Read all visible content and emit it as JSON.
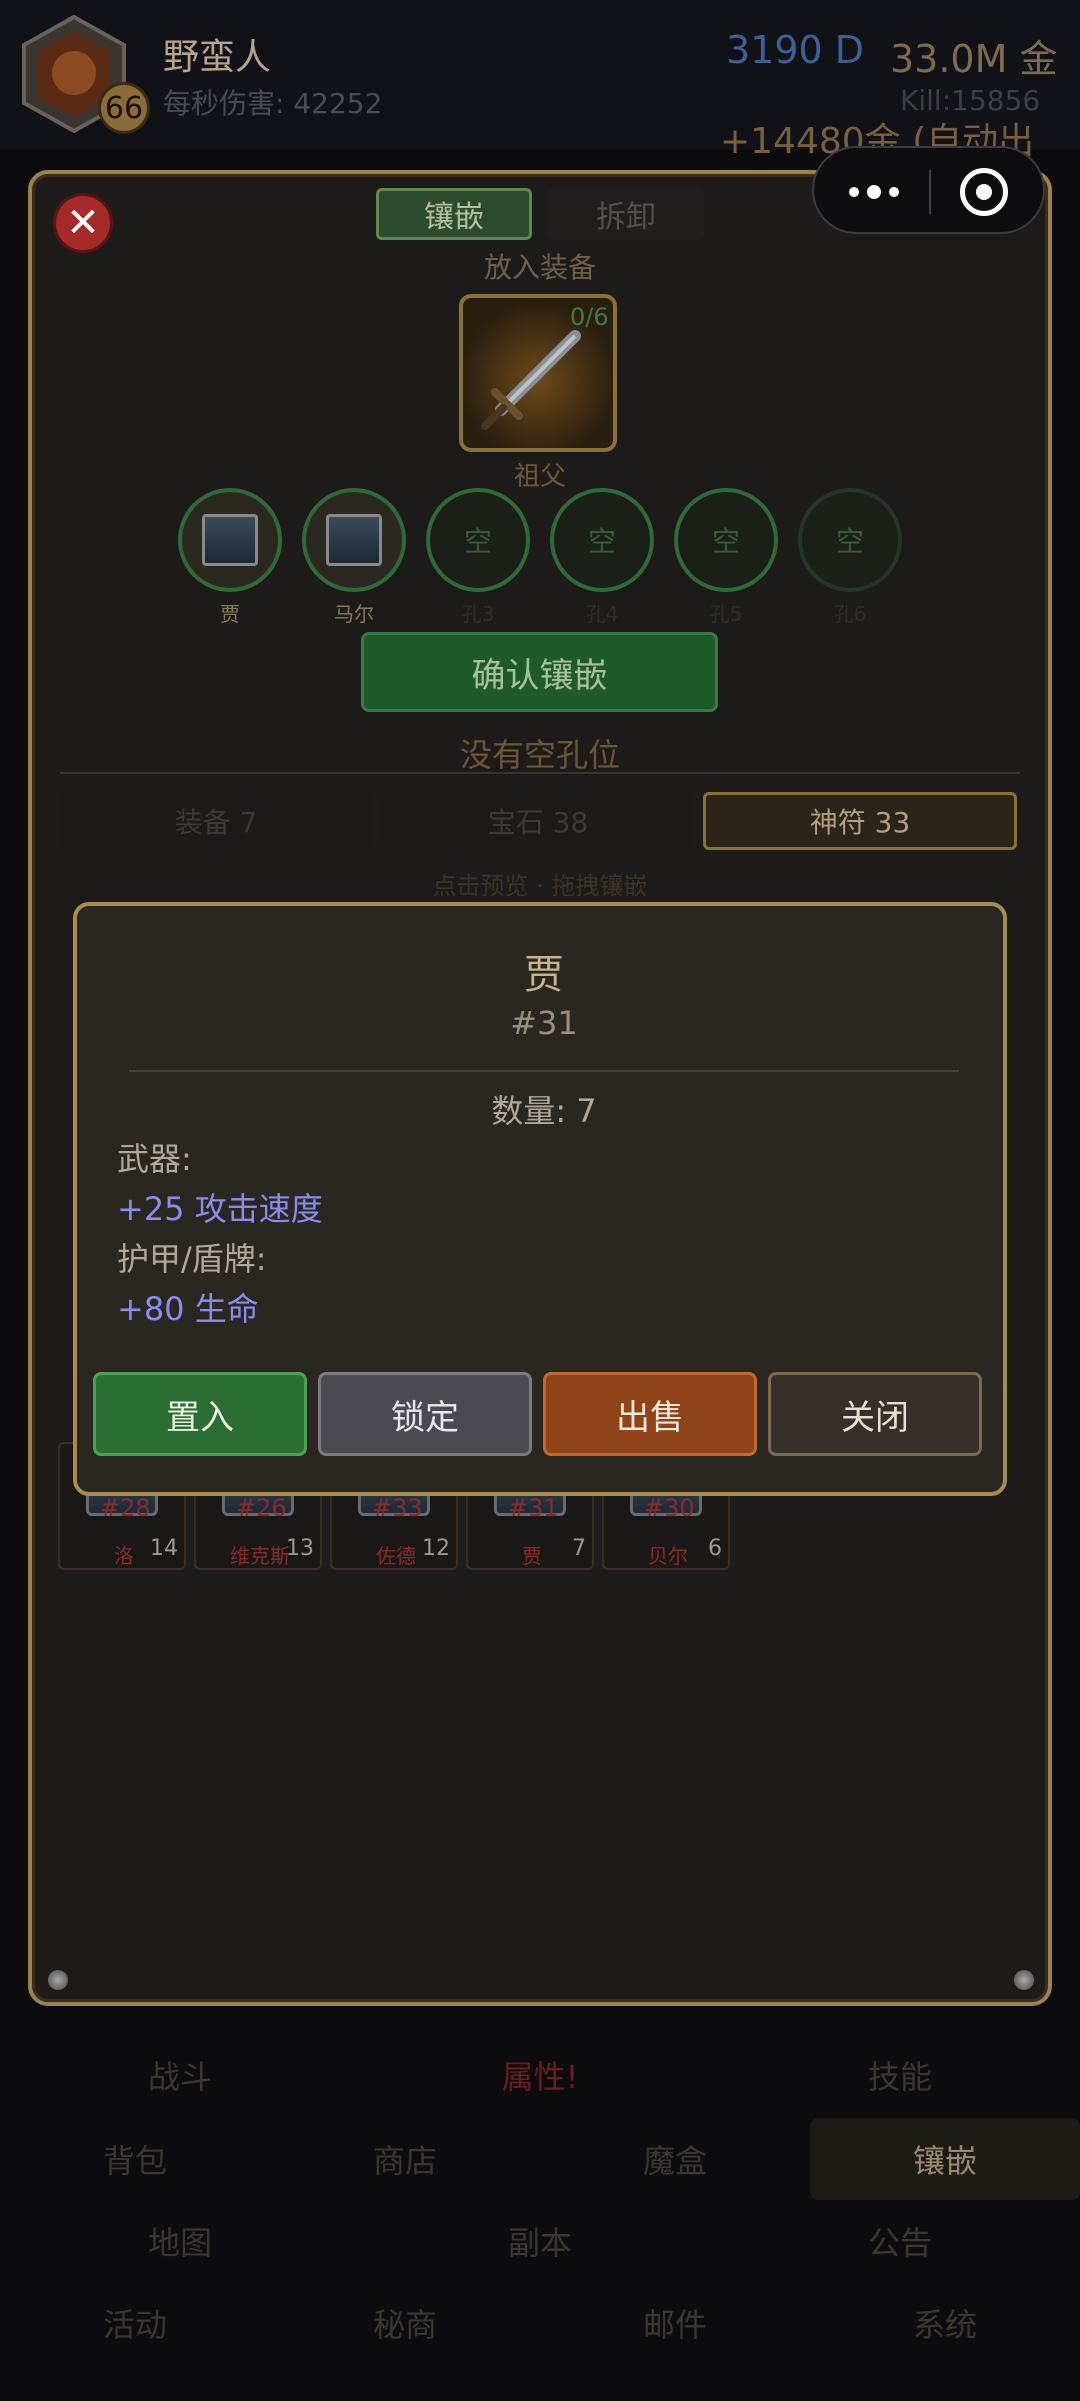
{
  "header": {
    "player_name": "野蛮人",
    "level": "66",
    "dps": "每秒伤害: 42252",
    "diamonds": "3190 D",
    "gold": "33.0M 金",
    "kills": "Kill:15856",
    "auto_sell": "+14480金 (自动出售)"
  },
  "panel": {
    "tabs": [
      "镶嵌",
      "拆卸"
    ],
    "put_label": "放入装备",
    "equip_count": "0/6",
    "equip_name": "祖父",
    "sockets": [
      {
        "content": "",
        "label": "贾",
        "filled": true
      },
      {
        "content": "",
        "label": "马尔",
        "filled": true
      },
      {
        "content": "空",
        "label": "孔3",
        "filled": false
      },
      {
        "content": "空",
        "label": "孔4",
        "filled": false
      },
      {
        "content": "空",
        "label": "孔5",
        "filled": false
      },
      {
        "content": "空",
        "label": "孔6",
        "filled": false
      }
    ],
    "confirm_label": "确认镶嵌",
    "no_slot": "没有空孔位",
    "bottom_tabs": [
      "装备 7",
      "宝石 38",
      "神符 33"
    ],
    "hint": "点击预览 · 拖拽镶嵌",
    "rune_cells": [
      {
        "num": "#28",
        "name": "洛",
        "count": "14"
      },
      {
        "num": "#26",
        "name": "维克斯",
        "count": "13"
      },
      {
        "num": "#33",
        "name": "佐德",
        "count": "12"
      },
      {
        "num": "#31",
        "name": "贾",
        "count": "7"
      },
      {
        "num": "#30",
        "name": "贝尔",
        "count": "6"
      }
    ]
  },
  "popup": {
    "title": "贾",
    "id": "#31",
    "qty": "数量: 7",
    "weapon_label": "武器:",
    "weapon_stat": "+25 攻击速度",
    "armor_label": "护甲/盾牌:",
    "armor_stat": "+80 生命",
    "buttons": [
      "置入",
      "锁定",
      "出售",
      "关闭"
    ],
    "stat_color": "#8c8cf0"
  },
  "nav": {
    "row1": [
      "战斗",
      "属性!",
      "技能"
    ],
    "row2": [
      "背包",
      "商店",
      "魔盒",
      "镶嵌"
    ],
    "row3": [
      "地图",
      "副本",
      "公告"
    ],
    "row4": [
      "活动",
      "秘商",
      "邮件",
      "系统"
    ]
  }
}
